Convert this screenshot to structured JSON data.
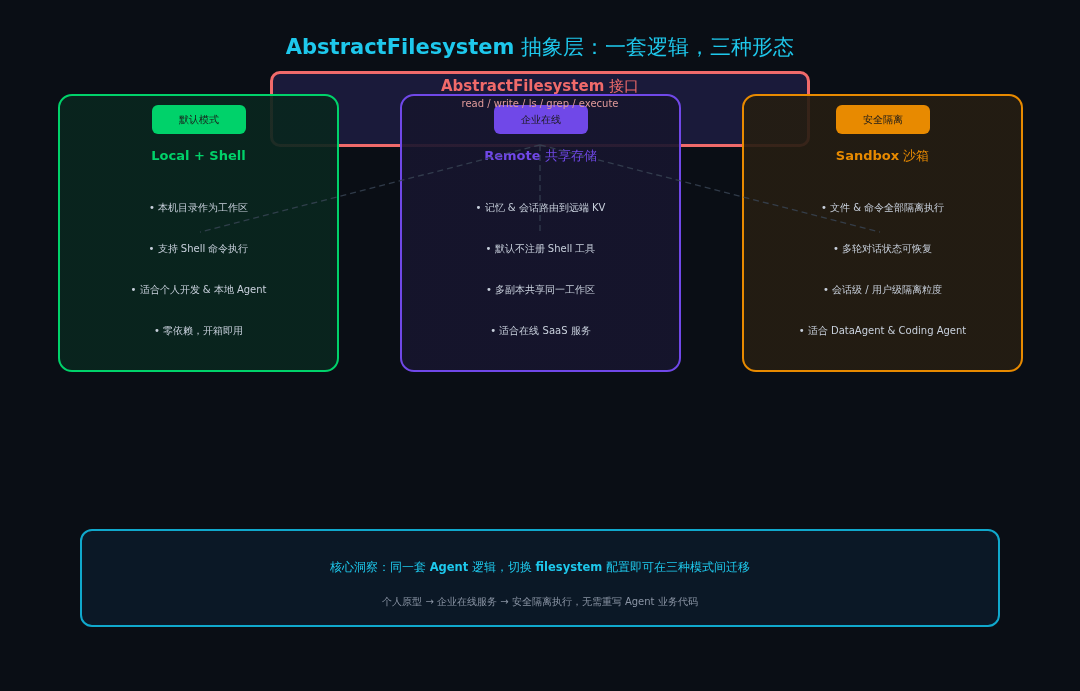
{
  "title": "**AbstractFilesystem** 抽象层：一套逻辑，三种形态",
  "interface": {
    "title": "**AbstractFilesystem** 接口",
    "methods": "read / write / ls / grep / execute"
  },
  "cards": [
    {
      "badge": "默认模式",
      "name": "Local + Shell",
      "color": "#00d26a",
      "items": [
        "• 本机目录作为工作区",
        "• 支持 Shell 命令执行",
        "• 适合个人开发 & 本地 Agent",
        "• 零依赖，开箱即用"
      ]
    },
    {
      "badge": "企业在线",
      "name": "Remote",
      "suffix": "共享存储",
      "color": "#7048e8",
      "items": [
        "• 记忆 & 会话路由到远端 KV",
        "• 默认不注册 Shell 工具",
        "• 多副本共享同一工作区",
        "• 适合在线 SaaS 服务"
      ]
    },
    {
      "badge": "安全隔离",
      "name": "Sandbox",
      "suffix": "沙箱",
      "color": "#e88a00",
      "items": [
        "• 文件 & 命令全部隔离执行",
        "• 多轮对话状态可恢复",
        "• 会话级 / 用户级隔离粒度",
        "• 适合 DataAgent & Coding Agent"
      ]
    }
  ],
  "insight": {
    "headline": "核心洞察：同一套 **Agent** 逻辑，切换 **filesystem** 配置即可在三种模式间迁移",
    "subline": "个人原型 → 企业在线服务 → 安全隔离执行，无需重写 Agent 业务代码"
  }
}
